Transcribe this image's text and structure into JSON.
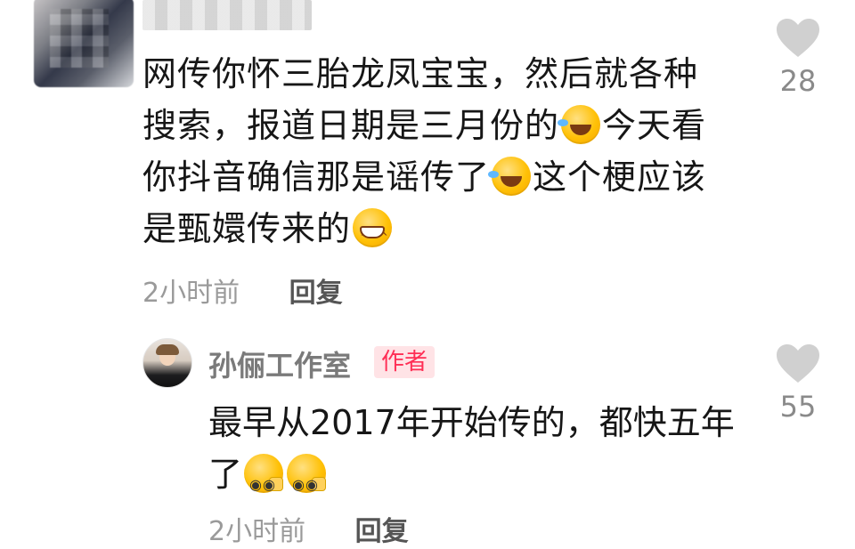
{
  "comment": {
    "user_name_obscured": true,
    "text_segments": [
      {
        "type": "text",
        "value": "网传你怀三胎龙凤宝宝，然后就各种搜索，报道日期是三月份的"
      },
      {
        "type": "emoji",
        "value": "rolling-on-floor-laughing-icon"
      },
      {
        "type": "text",
        "value": "今天看你抖音确信那是谣传了"
      },
      {
        "type": "emoji",
        "value": "rolling-on-floor-laughing-icon"
      },
      {
        "type": "text",
        "value": "这个梗应该是甄嬛传来的"
      },
      {
        "type": "emoji",
        "value": "grinning-face-icon"
      }
    ],
    "time": "2小时前",
    "reply_label": "回复",
    "like_count": "28",
    "like_icon": "heart-icon"
  },
  "reply": {
    "user_name": "孙俪工作室",
    "badge": "作者",
    "text_segments": [
      {
        "type": "text",
        "value": "最早从2017年开始传的，都快五年了"
      },
      {
        "type": "emoji",
        "value": "shy-peeking-face-icon"
      },
      {
        "type": "emoji",
        "value": "shy-peeking-face-icon"
      }
    ],
    "time": "2小时前",
    "reply_label": "回复",
    "like_count": "55",
    "like_icon": "heart-icon"
  },
  "colors": {
    "text": "#161616",
    "muted": "#9a9a9a",
    "heart": "#d0d0d0",
    "badge_bg": "#ffe3e6",
    "badge_text": "#ff2e55"
  }
}
